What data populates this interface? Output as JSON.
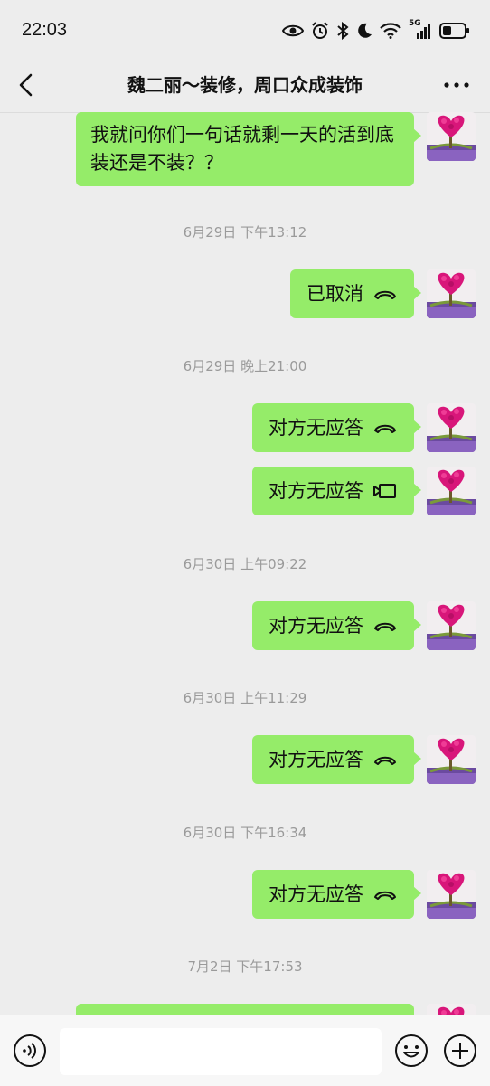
{
  "status_bar": {
    "time": "22:03",
    "network": "5G",
    "icons": [
      "eye-icon",
      "alarm-icon",
      "bluetooth-icon",
      "moon-icon",
      "wifi-icon",
      "signal-icon",
      "battery-icon"
    ]
  },
  "header": {
    "title": "魏二丽～装修，周口众成装饰",
    "back_icon": "chevron-left-icon",
    "more_icon": "more-dots-icon"
  },
  "colors": {
    "bubble": "#95ec69",
    "background": "#ededed",
    "timestamp_text": "#9a9a9a"
  },
  "messages": [
    {
      "type": "text",
      "text": "我就问你们一句话就剩一天的活到底装还是不装？？"
    },
    {
      "type": "time",
      "text": "6月29日 下午13:12"
    },
    {
      "type": "call",
      "text": "已取消",
      "icon": "phone-hangup-icon"
    },
    {
      "type": "time",
      "text": "6月29日 晚上21:00"
    },
    {
      "type": "call",
      "text": "对方无应答",
      "icon": "phone-hangup-icon"
    },
    {
      "type": "call",
      "text": "对方无应答",
      "icon": "video-call-icon"
    },
    {
      "type": "time",
      "text": "6月30日 上午09:22"
    },
    {
      "type": "call",
      "text": "对方无应答",
      "icon": "phone-hangup-icon"
    },
    {
      "type": "time",
      "text": "6月30日 上午11:29"
    },
    {
      "type": "call",
      "text": "对方无应答",
      "icon": "phone-hangup-icon"
    },
    {
      "type": "time",
      "text": "6月30日 下午16:34"
    },
    {
      "type": "call",
      "text": "对方无应答",
      "icon": "phone-hangup-icon"
    },
    {
      "type": "time",
      "text": "7月2日 下午17:53"
    }
  ],
  "input_bar": {
    "voice_icon": "voice-icon",
    "emoji_icon": "emoji-icon",
    "plus_icon": "plus-icon",
    "placeholder": ""
  }
}
